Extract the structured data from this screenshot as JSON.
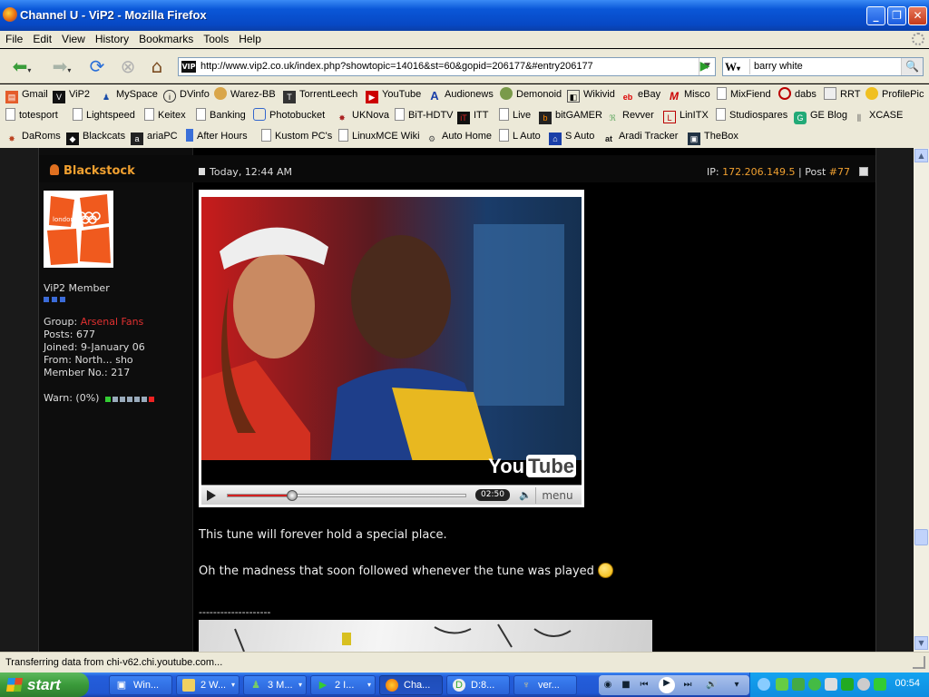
{
  "window": {
    "title": "Channel U - ViP2 - Mozilla Firefox"
  },
  "menu": [
    "File",
    "Edit",
    "View",
    "History",
    "Bookmarks",
    "Tools",
    "Help"
  ],
  "nav": {
    "url": "http://www.vip2.co.uk/index.php?showtopic=14016&st=60&gopid=206177&#entry206177",
    "search_engine": "W",
    "search_text": "barry white"
  },
  "bookmarks_row1": [
    "Gmail",
    "ViP2",
    "MySpace",
    "DVinfo",
    "Warez-BB",
    "TorrentLeech",
    "YouTube",
    "Audionews",
    "Demonoid",
    "Wikivid",
    "eBay",
    "Misco",
    "MixFiend",
    "dabs",
    "RRT",
    "ProfilePic"
  ],
  "bookmarks_row2": [
    "totesport",
    "Lightspeed",
    "Keitex",
    "Banking",
    "Photobucket",
    "UKNova",
    "BiT-HDTV",
    "ITT",
    "Live",
    "bitGAMER",
    "Revver",
    "LinITX",
    "Studiospares",
    "GE Blog",
    "XCASE"
  ],
  "bookmarks_row3": [
    "DaRoms",
    "Blackcats",
    "ariaPC",
    "After Hours",
    "Kustom PC's",
    "LinuxMCE Wiki",
    "Auto Home",
    "L Auto",
    "S Auto",
    "Aradi Tracker",
    "TheBox"
  ],
  "post": {
    "author": "Blackstock",
    "date": "Today, 12:44 AM",
    "ip_label": "IP: ",
    "ip": "172.206.149.5",
    "sep": " | ",
    "post_label": "Post ",
    "post_num": "#77",
    "user": {
      "rank": "ViP2 Member",
      "group_label": "Group: ",
      "group": "Arsenal Fans",
      "posts": "Posts: 677",
      "joined": "Joined: 9-January 06",
      "from": "From: North... sho",
      "member_no": "Member No.: 217",
      "warn": "Warn: (0%)",
      "avatar_text": "london"
    },
    "video": {
      "time": "02:50",
      "menu": "menu",
      "brand_you": "You",
      "brand_tube": "Tube",
      "progress": 0.27
    },
    "line1": "This tune will forever hold a special place.",
    "line2": "Oh the madness that soon followed whenever the tune was played",
    "divider": "--------------------"
  },
  "status": "Transferring data from chi-v62.chi.youtube.com...",
  "taskbar": {
    "start": "start",
    "tasks": [
      "Win...",
      "2 W...",
      "3 M...",
      "2 I...",
      "Cha...",
      "D:8...",
      "ver..."
    ],
    "clock": "00:54"
  }
}
